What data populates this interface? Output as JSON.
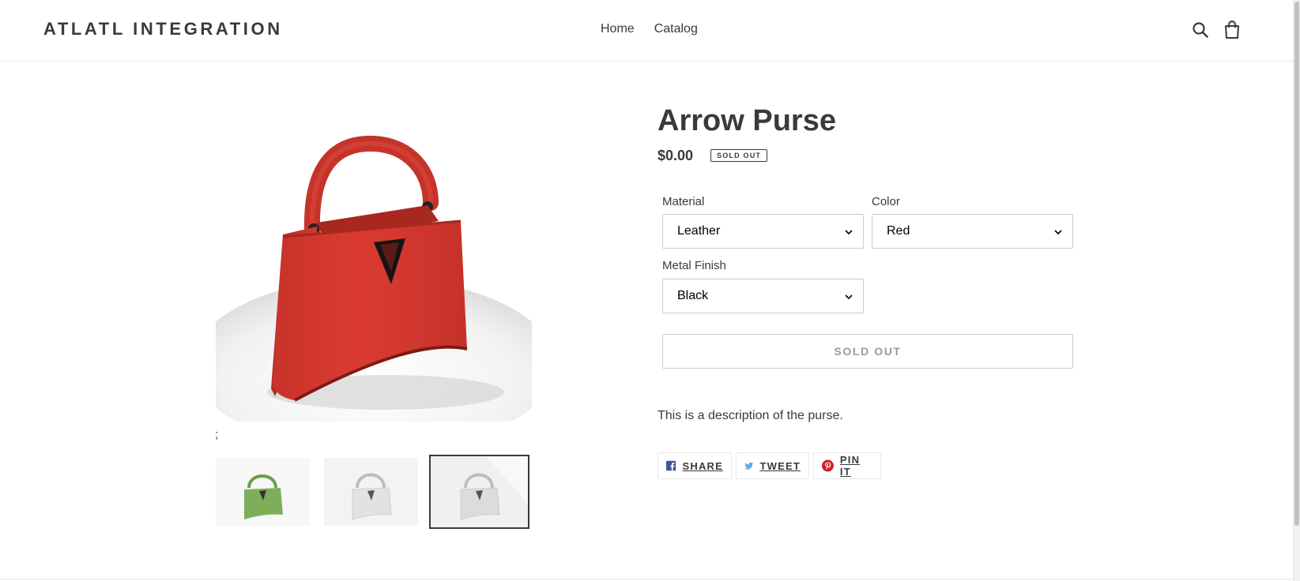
{
  "header": {
    "logo": "ATLATL INTEGRATION",
    "nav": [
      {
        "label": "Home"
      },
      {
        "label": "Catalog"
      }
    ],
    "search_icon": "search-icon",
    "cart_icon": "cart-icon"
  },
  "gallery": {
    "semicolon_text": ";",
    "main_image_alt": "red-purse-image",
    "thumbnails": [
      {
        "color": "#7fae5a",
        "name": "green-purse-thumbnail"
      },
      {
        "color": "#e6e6e6",
        "name": "white-purse-thumbnail"
      },
      {
        "color": "#dedede",
        "name": "white-purse-thumbnail-selected"
      }
    ]
  },
  "product": {
    "title": "Arrow Purse",
    "price": "$0.00",
    "badge": "SOLD OUT",
    "options": {
      "material": {
        "label": "Material",
        "value": "Leather"
      },
      "color": {
        "label": "Color",
        "value": "Red"
      },
      "metal_finish": {
        "label": "Metal Finish",
        "value": "Black"
      }
    },
    "add_button": "SOLD OUT",
    "description": "This is a description of the purse."
  },
  "share": {
    "facebook": "SHARE",
    "twitter": "TWEET",
    "pinterest": "PIN IT"
  },
  "colors": {
    "text": "#3a3a3a",
    "purse_red": "#d9392e",
    "facebook": "#3b5998",
    "twitter": "#55acee",
    "pinterest": "#cb2027"
  }
}
